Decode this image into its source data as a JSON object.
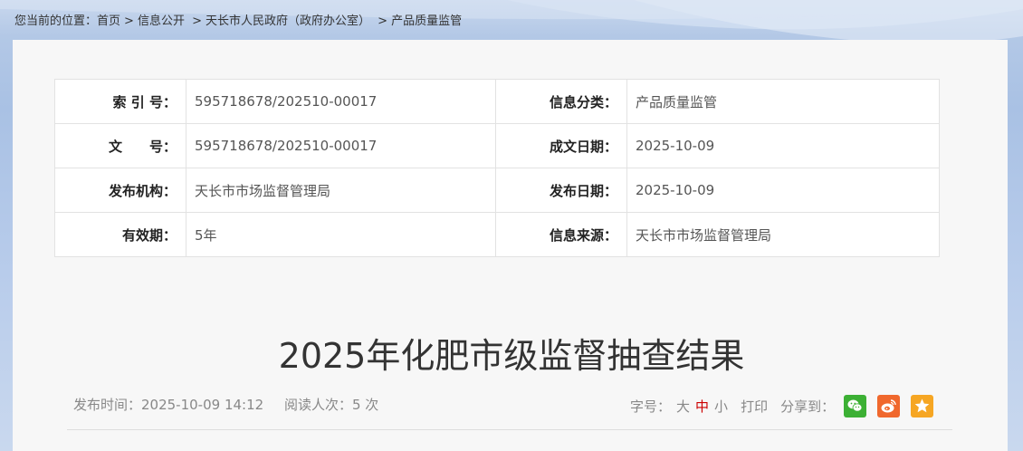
{
  "breadcrumb": {
    "prefix": "您当前的位置：",
    "items": [
      "首页",
      "信息公开",
      "天长市人民政府（政府办公室）",
      "产品质量监管"
    ],
    "separator": ">"
  },
  "meta": {
    "index_label": "索 引 号：",
    "index_value": "595718678/202510-00017",
    "category_label": "信息分类：",
    "category_value": "产品质量监管",
    "doc_no_label": "文　　号：",
    "doc_no_value": "595718678/202510-00017",
    "created_label": "成文日期：",
    "created_value": "2025-10-09",
    "publisher_label": "发布机构：",
    "publisher_value": "天长市市场监督管理局",
    "published_label": "发布日期：",
    "published_value": "2025-10-09",
    "validity_label": "有效期：",
    "validity_value": "5年",
    "source_label": "信息来源：",
    "source_value": "天长市市场监督管理局"
  },
  "article": {
    "title": "2025年化肥市级监督抽查结果",
    "publish_time": "发布时间：2025-10-09 14:12",
    "read_count": "阅读人次：5 次"
  },
  "tools": {
    "font_size_label": "字号：",
    "font_large": "大",
    "font_medium": "中",
    "font_small": "小",
    "print": "打印",
    "share_label": "分享到：",
    "share_icons": [
      "wechat-icon",
      "weibo-icon",
      "favorite-icon"
    ],
    "colors": {
      "wechat": "#3cb034",
      "weibo": "#f0682d",
      "favorite": "#f6a623",
      "active_font": "#cc0000"
    }
  }
}
